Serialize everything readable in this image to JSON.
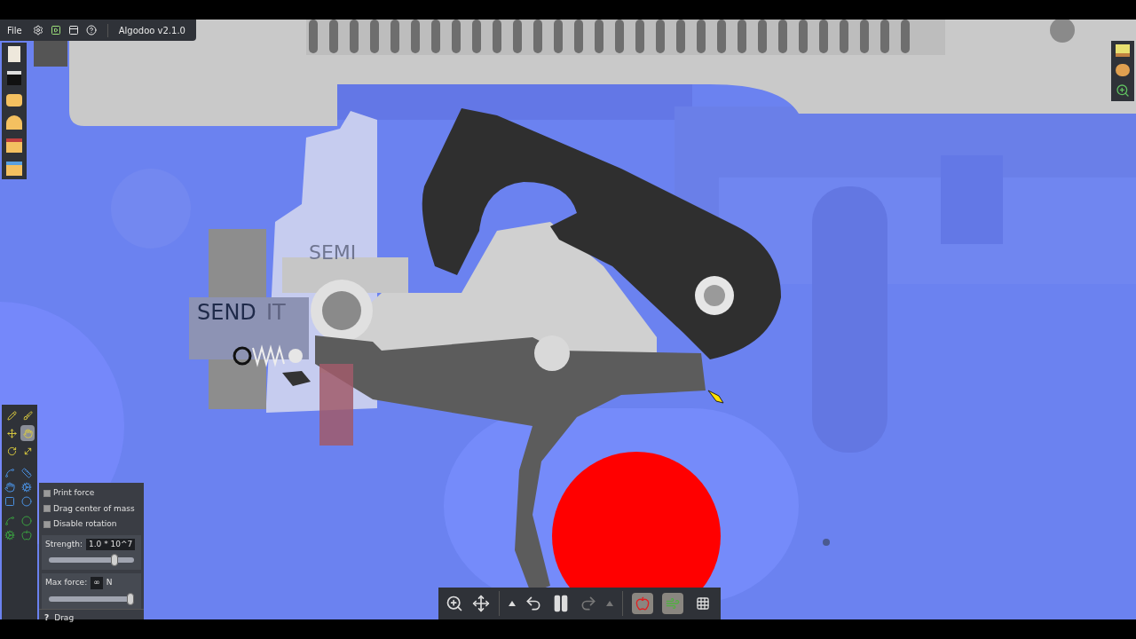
{
  "menu_bar": {
    "items": [
      "File"
    ],
    "app_title": "Algodoo v2.1.0"
  },
  "scene": {
    "labels": [
      {
        "text": "SEMI"
      },
      {
        "text": "SEND"
      },
      {
        "text": "IT"
      }
    ]
  },
  "tools": [
    {
      "selected": false
    },
    {
      "selected": false
    },
    {
      "selected": false
    },
    {
      "selected": true
    },
    {
      "selected": false
    },
    {
      "selected": false
    }
  ],
  "drag_panel": {
    "options": [
      {
        "label": "Print force",
        "checked": false
      },
      {
        "label": "Drag center of mass",
        "checked": false
      },
      {
        "label": "Disable rotation",
        "checked": false
      }
    ],
    "strength": {
      "label": "Strength:",
      "value": "1.0 * 10^7",
      "level": 0.8
    },
    "max_force": {
      "label": "Max force:",
      "value": "∞",
      "unit": "N",
      "level": 1.0
    },
    "help": {
      "icon_text": "?",
      "label": "Drag"
    }
  },
  "sim_toolbar": {
    "paused": false,
    "toggles": [
      {
        "on": true
      },
      {
        "on": true
      },
      {
        "on": false
      }
    ]
  }
}
